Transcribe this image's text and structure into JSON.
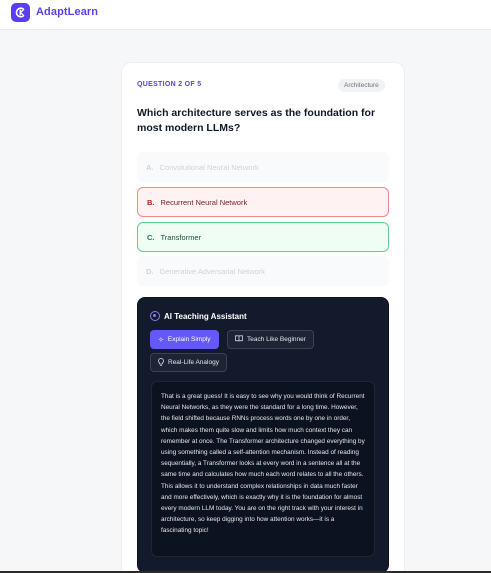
{
  "app": {
    "brand": "AdaptLearn",
    "accent": "#5b3df5"
  },
  "quiz": {
    "progress_label": "QUESTION 2 OF 5",
    "tag": "Architecture",
    "question": "Which architecture serves as the foundation for most modern LLMs?",
    "options": [
      {
        "letter": "A.",
        "text": "Convolutional Neural Network",
        "state": "disabled"
      },
      {
        "letter": "B.",
        "text": "Recurrent Neural Network",
        "state": "incorrect"
      },
      {
        "letter": "C.",
        "text": "Transformer",
        "state": "correct"
      },
      {
        "letter": "D.",
        "text": "Generative Adversarial Network",
        "state": "disabled"
      }
    ]
  },
  "assistant": {
    "title": "AI Teaching Assistant",
    "buttons": [
      {
        "label": "Explain Simply",
        "icon": "sparkles-icon",
        "active": true
      },
      {
        "label": "Teach Like Beginner",
        "icon": "book-icon",
        "active": false
      },
      {
        "label": "Real-Life Analogy",
        "icon": "lightbulb-icon",
        "active": false
      }
    ],
    "response": "That is a great guess! It is easy to see why you would think of Recurrent Neural Networks, as they were the standard for a long time. However, the field shifted because RNNs process words one by one in order, which makes them quite slow and limits how much context they can remember at once. The Transformer architecture changed everything by using something called a self-attention mechanism. Instead of reading sequentially, a Transformer looks at every word in a sentence all at the same time and calculates how much each word relates to all the others. This allows it to understand complex relationships in data much faster and more effectively, which is exactly why it is the foundation for almost every modern LLM today. You are on the right track with your interest in architecture, so keep digging into how attention works—it is a fascinating topic!"
  }
}
